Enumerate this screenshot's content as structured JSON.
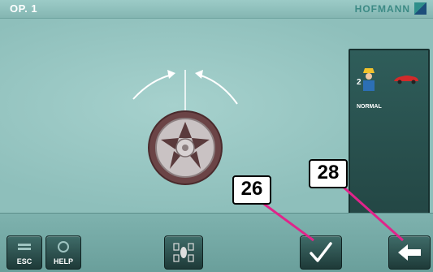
{
  "header": {
    "title": "OP. 1",
    "brand": "HOFMANN"
  },
  "side_panel": {
    "mode_label": "NORMAL",
    "operator_digit": "2"
  },
  "footer": {
    "esc_label": "ESC",
    "help_label": "HELP"
  },
  "callouts": {
    "confirm_number": "26",
    "back_number": "28"
  },
  "colors": {
    "callout_line": "#e0248a",
    "background": "#8fc0bc",
    "panel": "#2f5d5a"
  },
  "icons": [
    "operator-icon",
    "car-icon",
    "wheel-icon",
    "rotate-arrows-icon",
    "wheel-position-icon",
    "checkmark-icon",
    "back-arrow-icon",
    "esc-icon",
    "help-icon"
  ]
}
